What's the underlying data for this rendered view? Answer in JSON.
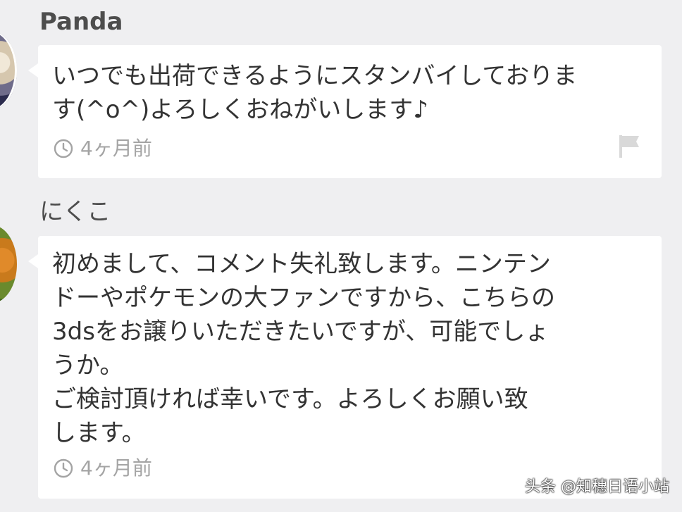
{
  "comments": [
    {
      "username": "Panda",
      "message": "いつでも出荷できるようにスタンバイしておりま\nす(^o^)よろしくおねがいします♪",
      "time": "4ヶ月前",
      "icons": {
        "time": "clock-icon",
        "report": "flag-icon"
      }
    },
    {
      "username": "にくこ",
      "message": "初めまして、コメント失礼致します。ニンテン\nドーやポケモンの大ファンですから、こちらの\n3dsをお譲りいただきたいですが、可能でしょ\nうか。\nご検討頂ければ幸いです。よろしくお願い致\nします。",
      "time": "4ヶ月前",
      "icons": {
        "time": "clock-icon"
      }
    }
  ],
  "watermark": "头条 @知穗日语小站",
  "colors": {
    "background": "#efeff1",
    "bubble": "#ffffff",
    "meta": "#a4a4a4",
    "text": "#333333"
  }
}
